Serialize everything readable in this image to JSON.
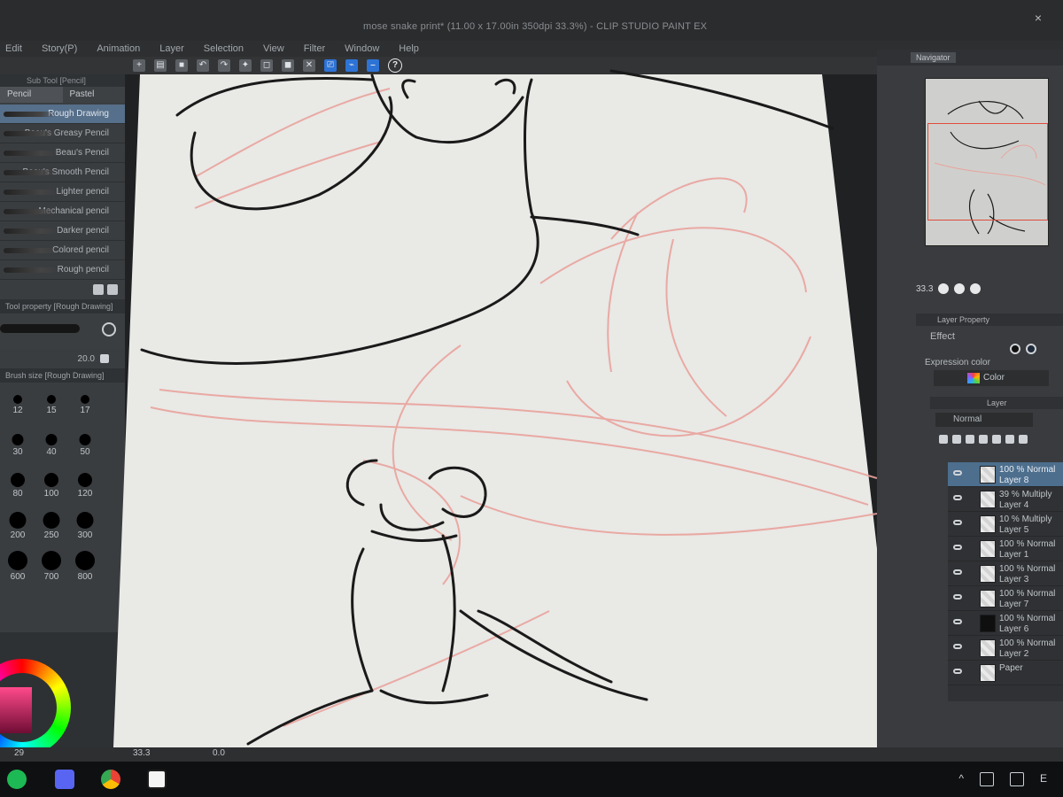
{
  "window": {
    "title": "mose snake print* (11.00 x 17.00in 350dpi 33.3%) - CLIP STUDIO PAINT EX"
  },
  "menu": {
    "items": [
      "Edit",
      "Story(P)",
      "Animation",
      "Layer",
      "Selection",
      "View",
      "Filter",
      "Window",
      "Help"
    ]
  },
  "left_panel": {
    "subtool_header": "Sub Tool [Pencil]",
    "tabs": [
      "Pencil",
      "Pastel"
    ],
    "tools": [
      {
        "label": "Rough Drawing",
        "active": true
      },
      {
        "label": "Beau's Greasy Pencil",
        "active": false
      },
      {
        "label": "Beau's Pencil",
        "active": false
      },
      {
        "label": "Beau's Smooth Pencil",
        "active": false
      },
      {
        "label": "Lighter pencil",
        "active": false
      },
      {
        "label": "Mechanical pencil",
        "active": false
      },
      {
        "label": "Darker pencil",
        "active": false
      },
      {
        "label": "Colored pencil",
        "active": false
      },
      {
        "label": "Rough pencil",
        "active": false
      }
    ],
    "tool_property_header": "Tool property [Rough Drawing]",
    "brush_size_value": "20.0",
    "brush_size_header": "Brush size [Rough Drawing]",
    "size_grid": {
      "labels": [
        "12",
        "15",
        "17",
        "30",
        "40",
        "50",
        "80",
        "100",
        "120",
        "200",
        "250",
        "300",
        "600",
        "700",
        "800"
      ]
    }
  },
  "right_panel": {
    "navigator_tab": "Navigator",
    "zoom_value": "33.3",
    "layer_property_tab": "Layer Property",
    "effect_label": "Effect",
    "expression_color_label": "Expression color",
    "expression_color_value": "Color",
    "layer_tab": "Layer",
    "blend_mode": "Normal",
    "layers": [
      {
        "opacity_mode": "100 % Normal",
        "name": "Layer 8",
        "active": true,
        "thumb": "light"
      },
      {
        "opacity_mode": "39 % Multiply",
        "name": "Layer 4",
        "active": false,
        "thumb": "light"
      },
      {
        "opacity_mode": "10 % Multiply",
        "name": "Layer 5",
        "active": false,
        "thumb": "light"
      },
      {
        "opacity_mode": "100 % Normal",
        "name": "Layer 1",
        "active": false,
        "thumb": "light"
      },
      {
        "opacity_mode": "100 % Normal",
        "name": "Layer 3",
        "active": false,
        "thumb": "light"
      },
      {
        "opacity_mode": "100 % Normal",
        "name": "Layer 7",
        "active": false,
        "thumb": "light"
      },
      {
        "opacity_mode": "100 % Normal",
        "name": "Layer 6",
        "active": false,
        "thumb": "dark"
      },
      {
        "opacity_mode": "100 % Normal",
        "name": "Layer 2",
        "active": false,
        "thumb": "light"
      },
      {
        "opacity_mode": "Paper",
        "name": "",
        "active": false,
        "thumb": "light"
      }
    ]
  },
  "status": {
    "left_value": "29",
    "zoom": "33.3",
    "angle": "0.0"
  },
  "colors": {
    "sketch_red": "#e9a39c",
    "line_black": "#1a1a1a",
    "paper": "#e9e9e6",
    "ui_dark": "#2d2f31"
  },
  "taskbar": {
    "apps": [
      "spotify-icon",
      "discord-icon",
      "chrome-icon",
      "clip-studio-icon"
    ]
  }
}
